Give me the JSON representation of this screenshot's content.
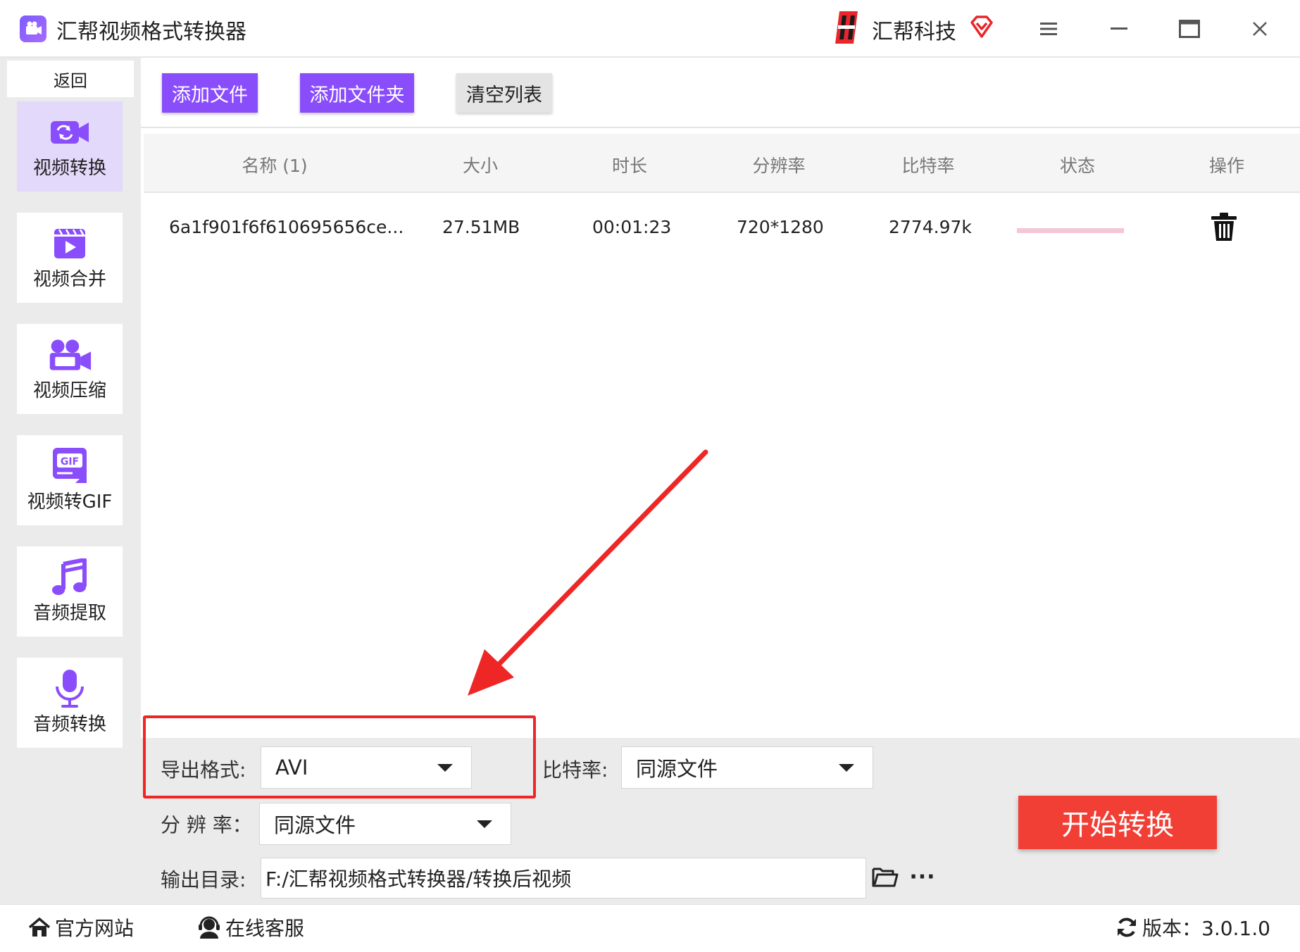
{
  "window": {
    "title": "汇帮视频格式转换器",
    "brand": "汇帮科技"
  },
  "sidebar": {
    "back_label": "返回",
    "items": [
      {
        "label": "视频转换",
        "icon": "video-convert-icon",
        "active": true
      },
      {
        "label": "视频合并",
        "icon": "video-merge-icon",
        "active": false
      },
      {
        "label": "视频压缩",
        "icon": "video-compress-icon",
        "active": false
      },
      {
        "label": "视频转GIF",
        "icon": "gif-icon",
        "active": false
      },
      {
        "label": "音频提取",
        "icon": "music-note-icon",
        "active": false
      },
      {
        "label": "音频转换",
        "icon": "microphone-icon",
        "active": false
      }
    ]
  },
  "toolbar": {
    "add_file": "添加文件",
    "add_folder": "添加文件夹",
    "clear_list": "清空列表"
  },
  "table": {
    "headers": {
      "name": "名称 (1)",
      "size": "大小",
      "duration": "时长",
      "resolution": "分辨率",
      "bitrate": "比特率",
      "status": "状态",
      "action": "操作"
    },
    "rows": [
      {
        "name": "6a1f901f6f610695656ce...",
        "size": "27.51MB",
        "duration": "00:01:23",
        "resolution": "720*1280",
        "bitrate": "2774.97k",
        "progress": 0
      }
    ]
  },
  "settings": {
    "format_label": "导出格式:",
    "format_value": "AVI",
    "bitrate_label": "比特率:",
    "bitrate_value": "同源文件",
    "resolution_label": "分 辨 率：",
    "resolution_value": "同源文件",
    "output_label": "输出目录:",
    "output_path": "F:/汇帮视频格式转换器/转换后视频",
    "more_label": "···",
    "start_button": "开始转换"
  },
  "footer": {
    "website": "官方网站",
    "support": "在线客服",
    "version": "版本：3.0.1.0"
  },
  "colors": {
    "accent": "#8a4dfb",
    "start": "#f23f36",
    "annotation": "#ee2626",
    "progress": "#f4c6d6"
  }
}
